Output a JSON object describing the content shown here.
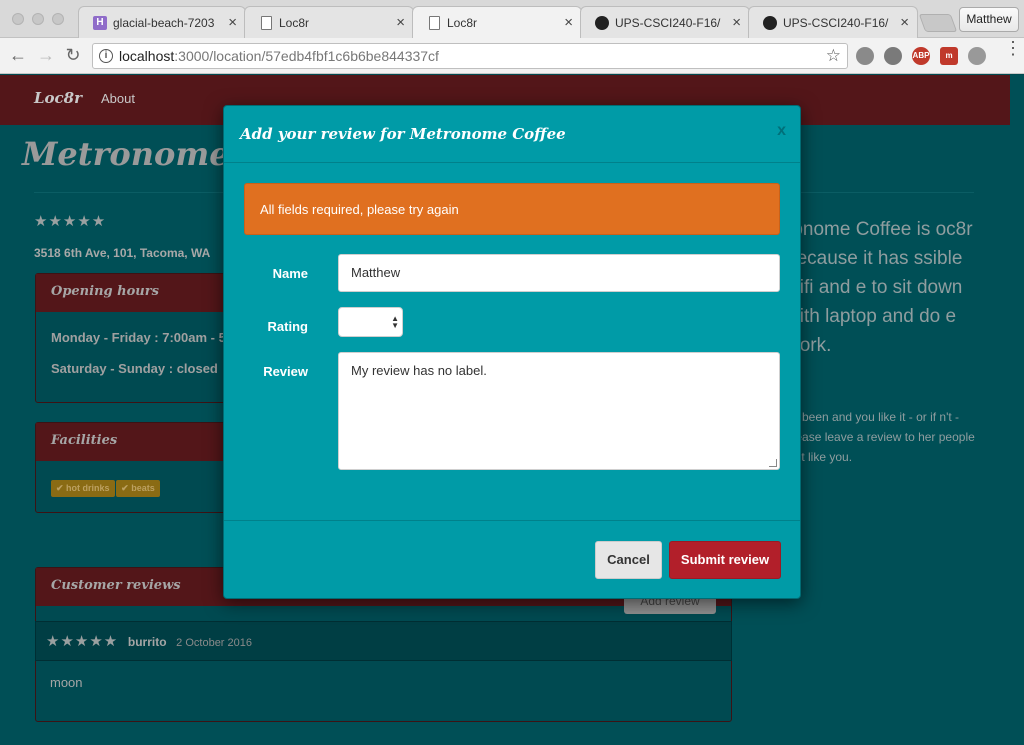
{
  "browser": {
    "tabs": [
      {
        "title": "glacial-beach-7203",
        "favicon": "heroku-icon",
        "active": false
      },
      {
        "title": "Loc8r",
        "favicon": "document-icon",
        "active": false
      },
      {
        "title": "Loc8r",
        "favicon": "document-icon",
        "active": true
      },
      {
        "title": "UPS-CSCI240-F16/",
        "favicon": "github-icon",
        "active": false
      },
      {
        "title": "UPS-CSCI240-F16/",
        "favicon": "github-icon",
        "active": false
      }
    ],
    "profile_name": "Matthew",
    "url_host": "localhost",
    "url_path": ":3000/location/57edb4fbf1c6b6be844337cf",
    "extensions": [
      {
        "name": "google-drive-icon",
        "label": "",
        "color": "#8a8a8a"
      },
      {
        "name": "dropbox-icon",
        "label": "",
        "color": "#7a7a7a"
      },
      {
        "name": "adblock-icon",
        "label": "ABP",
        "color": "#c0392b"
      },
      {
        "name": "red-m-extension-icon",
        "label": "m",
        "color": "#c0392b"
      },
      {
        "name": "owl-extension-icon",
        "label": "",
        "color": "#999999"
      }
    ]
  },
  "site": {
    "brand": "Loc8r",
    "nav_about": "About",
    "page_title": "Metronome Coffee",
    "rating_stars": "★★★★★",
    "address": "3518 6th Ave, 101, Tacoma, WA",
    "opening_hours": {
      "heading": "Opening hours",
      "lines": [
        "Monday - Friday : 7:00am - 5",
        "Saturday - Sunday : closed"
      ]
    },
    "facilities": {
      "heading": "Facilities",
      "items": [
        "✔ hot drinks",
        "✔ beats"
      ]
    },
    "reviews": {
      "heading": "Customer reviews",
      "add_button": "Add review",
      "items": [
        {
          "stars": "★★★★★",
          "author": "burrito",
          "date": "2 October 2016",
          "text": "moon"
        }
      ]
    },
    "sidebar": {
      "lead": "ronome Coffee is oc8r because it has ssible wifi and e to sit down with laptop and do e work.",
      "small": "ve been and you like it - or if n't - please leave a review to her people just like you."
    }
  },
  "modal": {
    "title": "Add your review for Metronome Coffee",
    "close": "x",
    "alert": "All fields required, please try again",
    "name_label": "Name",
    "name_value": "Matthew",
    "rating_label": "Rating",
    "review_label": "Review",
    "review_value": "My review has no label.",
    "cancel_label": "Cancel",
    "submit_label": "Submit review"
  }
}
